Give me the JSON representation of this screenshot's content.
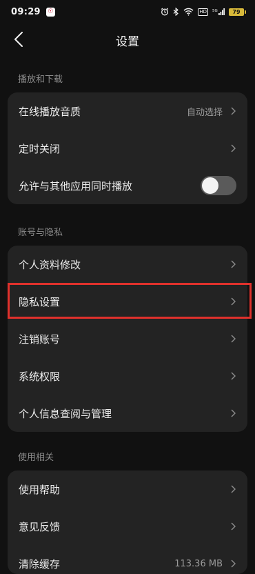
{
  "status_bar": {
    "time": "09:29",
    "app_badge": "☉",
    "signal_label": "5G",
    "battery": "79"
  },
  "header": {
    "title": "设置"
  },
  "sections": [
    {
      "label": "播放和下载",
      "items": [
        {
          "label": "在线播放音质",
          "value": "自动选择"
        },
        {
          "label": "定时关闭"
        },
        {
          "label": "允许与其他应用同时播放",
          "toggle": "off"
        }
      ]
    },
    {
      "label": "账号与隐私",
      "items": [
        {
          "label": "个人资料修改"
        },
        {
          "label": "隐私设置"
        },
        {
          "label": "注销账号"
        },
        {
          "label": "系统权限"
        },
        {
          "label": "个人信息查阅与管理"
        }
      ]
    },
    {
      "label": "使用相关",
      "items": [
        {
          "label": "使用帮助"
        },
        {
          "label": "意见反馈"
        },
        {
          "label": "清除缓存",
          "value": "113.36 MB"
        }
      ]
    }
  ],
  "colors": {
    "background": "#111111",
    "card": "#232323",
    "highlight": "#e0312c",
    "toggle_off": "#5a5a5a"
  }
}
